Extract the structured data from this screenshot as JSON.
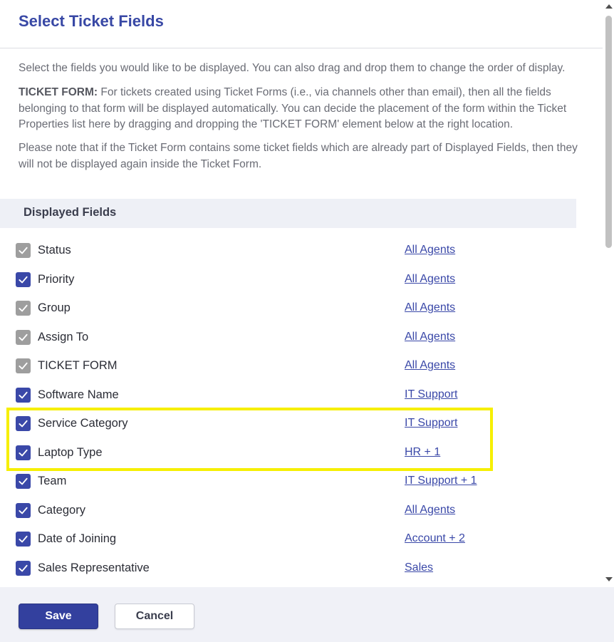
{
  "dialog": {
    "title": "Select Ticket Fields"
  },
  "description": {
    "intro": "Select the fields you would like to be displayed. You can also drag and drop them to change the order of display.",
    "ticket_form_label": "TICKET FORM:",
    "ticket_form_text": " For tickets created using Ticket Forms (i.e., via channels other than email), then all the fields belonging to that form will be displayed automatically. You can decide the placement of the form within the Ticket Properties list here by dragging and dropping the 'TICKET FORM' element below at the right location.",
    "note": "Please note that if the Ticket Form contains some ticket fields which are already part of Displayed Fields, then they will not be displayed again inside the Ticket Form."
  },
  "section": {
    "title": "Displayed Fields"
  },
  "fields": [
    {
      "label": "Status",
      "visibility": "All Agents",
      "checked": true,
      "locked": true
    },
    {
      "label": "Priority",
      "visibility": "All Agents",
      "checked": true,
      "locked": false
    },
    {
      "label": "Group",
      "visibility": "All Agents",
      "checked": true,
      "locked": true
    },
    {
      "label": "Assign To",
      "visibility": "All Agents",
      "checked": true,
      "locked": true
    },
    {
      "label": "TICKET FORM",
      "visibility": "All Agents",
      "checked": true,
      "locked": true
    },
    {
      "label": "Software Name",
      "visibility": "IT Support",
      "checked": true,
      "locked": false
    },
    {
      "label": "Service Category",
      "visibility": "IT Support",
      "checked": true,
      "locked": false
    },
    {
      "label": "Laptop Type",
      "visibility": "HR + 1",
      "checked": true,
      "locked": false
    },
    {
      "label": "Team",
      "visibility": "IT Support + 1",
      "checked": true,
      "locked": false
    },
    {
      "label": "Category",
      "visibility": "All Agents",
      "checked": true,
      "locked": false
    },
    {
      "label": "Date of Joining",
      "visibility": "Account + 2",
      "checked": true,
      "locked": false
    },
    {
      "label": "Sales Representative",
      "visibility": "Sales",
      "checked": true,
      "locked": false
    }
  ],
  "footer": {
    "save_label": "Save",
    "cancel_label": "Cancel"
  },
  "colors": {
    "accent": "#3a48a8",
    "locked_checkbox": "#9e9e9e",
    "highlight": "#f6ef00"
  }
}
